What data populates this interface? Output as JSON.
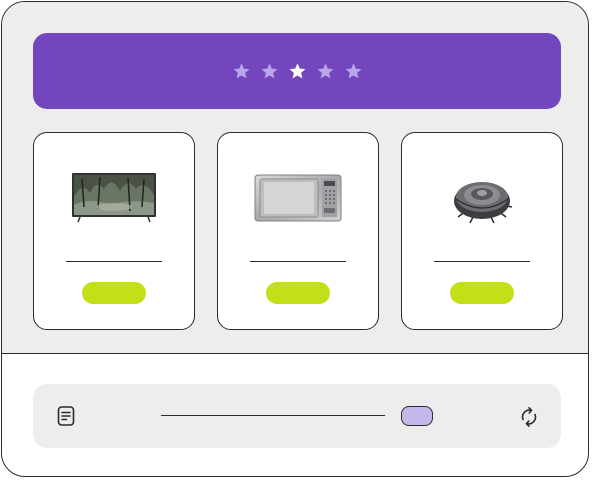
{
  "rating": {
    "value": 3,
    "max": 5,
    "stars": [
      {
        "state": "filled"
      },
      {
        "state": "filled"
      },
      {
        "state": "active"
      },
      {
        "state": "filled"
      },
      {
        "state": "filled"
      }
    ]
  },
  "colors": {
    "banner": "#7346bd",
    "star": "#b9a6ea",
    "star_active": "#ffffff",
    "button": "#c2df17",
    "slider_knob": "#c6b7ec",
    "panel": "#ededeb",
    "outline": "#2b2b30"
  },
  "products": [
    {
      "image": "tv-image",
      "label": ""
    },
    {
      "image": "microwave-image",
      "label": ""
    },
    {
      "image": "robot-vacuum-image",
      "label": ""
    }
  ],
  "toolbar": {
    "left_icon": "document-icon",
    "right_icon": "refresh-icon",
    "slider_value": 0.92
  }
}
